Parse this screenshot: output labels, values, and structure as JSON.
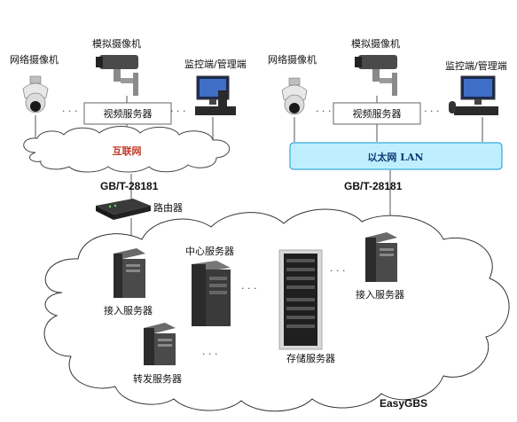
{
  "left_network": {
    "ipc_label": "网络摄像机",
    "analog_label": "模拟摄像机",
    "monitor_label": "监控端/管理端",
    "video_server_label": "视频服务器",
    "cloud_label": "互联网",
    "protocol_label": "GB/T-28181",
    "router_label": "路由器"
  },
  "right_network": {
    "ipc_label": "网络摄像机",
    "analog_label": "模拟摄像机",
    "monitor_label": "监控端/管理端",
    "video_server_label": "视频服务器",
    "lan_label": "以太网 LAN",
    "protocol_label": "GB/T-28181"
  },
  "platform": {
    "access_server_left_label": "接入服务器",
    "center_server_label": "中心服务器",
    "storage_server_label": "存储服务器",
    "access_server_right_label": "接入服务器",
    "forward_server_label": "转发服务器",
    "brand_label": "EasyGBS"
  },
  "separators": {
    "dots": ". . ."
  },
  "colors": {
    "lan_bar": "#bfefff",
    "lan_border": "#3aa9d6",
    "cloud_label_color": "#c0392b",
    "lan_label_color": "#0a3a72",
    "server_dark": "#2b2b2b"
  }
}
